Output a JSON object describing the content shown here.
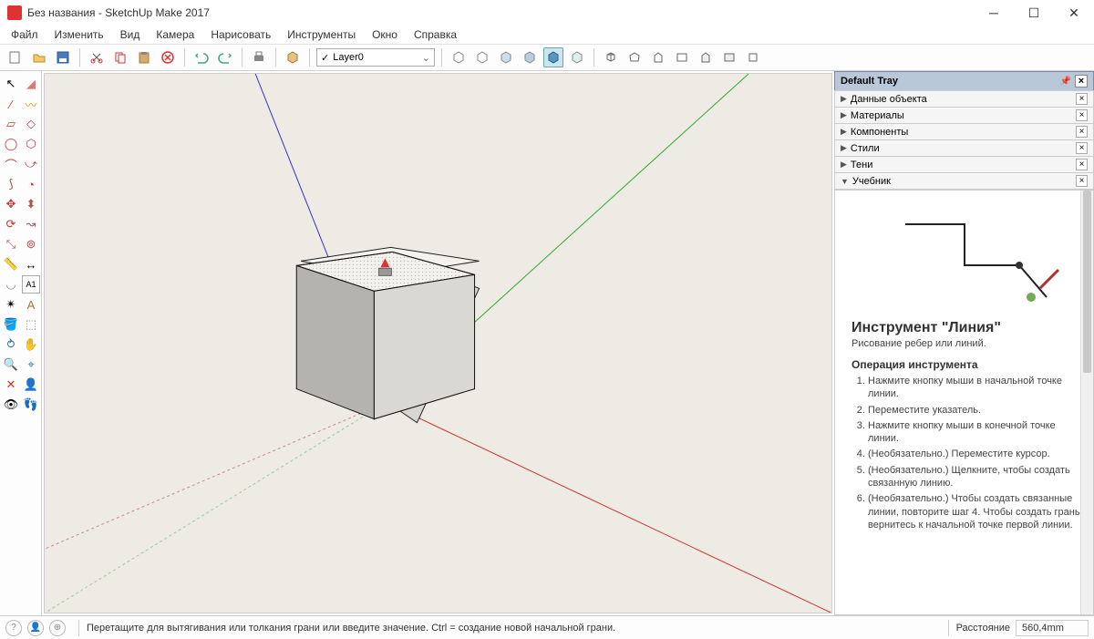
{
  "title": "Без названия - SketchUp Make 2017",
  "menu": [
    "Файл",
    "Изменить",
    "Вид",
    "Камера",
    "Нарисовать",
    "Инструменты",
    "Окно",
    "Справка"
  ],
  "layer": "Layer0",
  "tray": {
    "title": "Default Tray",
    "panels": [
      "Данные объекта",
      "Материалы",
      "Компоненты",
      "Стили",
      "Тени",
      "Учебник"
    ]
  },
  "instructor": {
    "title": "Инструмент \"Линия\"",
    "subtitle": "Рисование ребер или линий.",
    "section": "Операция инструмента",
    "steps": [
      "Нажмите кнопку мыши в начальной точке линии.",
      "Переместите указатель.",
      "Нажмите кнопку мыши в конечной точке линии.",
      "(Необязательно.) Переместите курсор.",
      "(Необязательно.) Щелкните, чтобы создать связанную линию.",
      "(Необязательно.) Чтобы создать связанные линии, повторите шаг 4. Чтобы создать грань, вернитесь к начальной точке первой линии."
    ]
  },
  "status": {
    "hint": "Перетащите для вытягивания или толкания грани или введите значение.  Ctrl = создание новой начальной грани.",
    "label": "Расстояние",
    "value": "560,4mm"
  }
}
